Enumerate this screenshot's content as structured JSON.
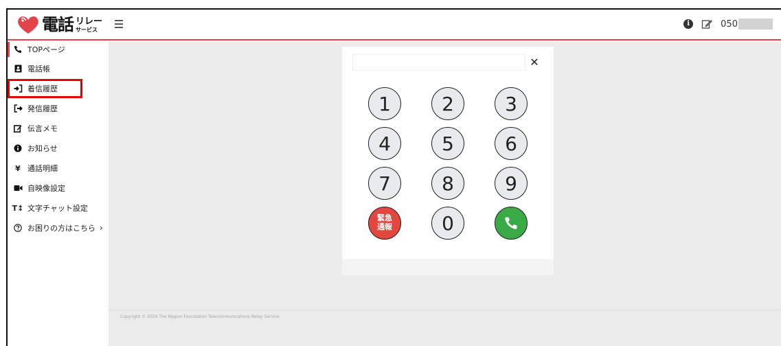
{
  "header": {
    "logo_main": "電話",
    "logo_sub_top": "リレー",
    "logo_sub_bottom": "サービス",
    "phone_prefix": "050"
  },
  "sidebar": {
    "items": [
      {
        "label": "TOPページ",
        "icon": "phone-handset-icon"
      },
      {
        "label": "電話帳",
        "icon": "address-book-icon"
      },
      {
        "label": "着信履歴",
        "icon": "sign-in-icon"
      },
      {
        "label": "発信履歴",
        "icon": "sign-out-icon"
      },
      {
        "label": "伝言メモ",
        "icon": "edit-icon"
      },
      {
        "label": "お知らせ",
        "icon": "info-icon"
      },
      {
        "label": "通話明細",
        "icon": "yen-icon"
      },
      {
        "label": "自映像設定",
        "icon": "video-camera-icon"
      },
      {
        "label": "文字チャット設定",
        "icon": "text-height-icon"
      },
      {
        "label": "お困りの方はこちら",
        "icon": "question-circle-icon"
      }
    ]
  },
  "dialpad": {
    "input_value": "",
    "keys": [
      "1",
      "2",
      "3",
      "4",
      "5",
      "6",
      "7",
      "8",
      "9",
      "0"
    ],
    "emergency_line1": "緊急",
    "emergency_line2": "通報"
  },
  "footer": {
    "copyright": "Copyright © 2024 The Nippon Foundation Telecommunications Relay Service"
  },
  "colors": {
    "accent_red": "#e0454a",
    "emergency_red": "#e2473f",
    "call_green": "#3aaa46",
    "highlight_red": "#e10000"
  }
}
